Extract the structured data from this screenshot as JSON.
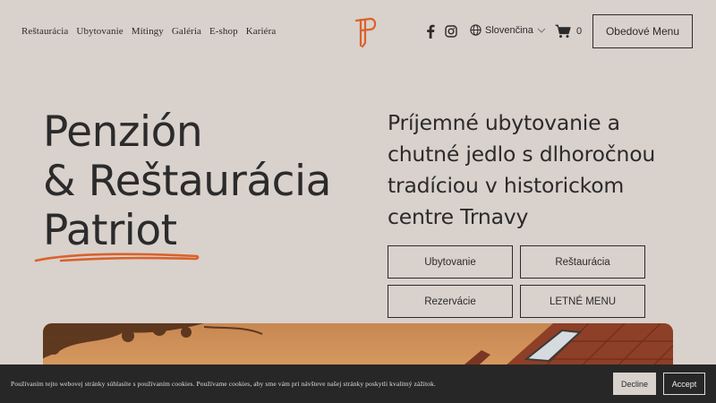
{
  "nav": {
    "items": [
      {
        "label": "Reštaurácia"
      },
      {
        "label": "Ubytovanie"
      },
      {
        "label": "Mítingy"
      },
      {
        "label": "Galéria"
      },
      {
        "label": "E-shop"
      },
      {
        "label": "Kariéra"
      }
    ],
    "language": "Slovenčina",
    "cart_count": "0",
    "menu_button": "Obedové Menu"
  },
  "icons": {
    "logo": "patriot-p-logo",
    "social": [
      "facebook-icon",
      "instagram-icon"
    ],
    "globe": "globe-icon",
    "chevron": "chevron-down-icon",
    "cart": "cart-icon"
  },
  "hero": {
    "title_lines": [
      "Penzión",
      "& Reštaurácia",
      "Patriot"
    ],
    "tagline": "Príjemné ubytovanie a chutné jedlo s dlhoročnou tradíciou v historickom centre Trnavy",
    "buttons": [
      {
        "label": "Ubytovanie"
      },
      {
        "label": "Reštaurácia"
      },
      {
        "label": "Rezervácie"
      },
      {
        "label": "LETNÉ MENU"
      }
    ]
  },
  "cookie": {
    "text": "Používaním tejto webovej stránky súhlasíte s používaním cookies. Používame cookies, aby sme vám pri návšteve našej stránky poskytli kvalitný zážitok.",
    "decline": "Decline",
    "accept": "Accept"
  },
  "colors": {
    "background": "#d9d1cc",
    "text": "#2b2b2b",
    "accent": "#d9622b",
    "cookie_bar": "#272727"
  }
}
